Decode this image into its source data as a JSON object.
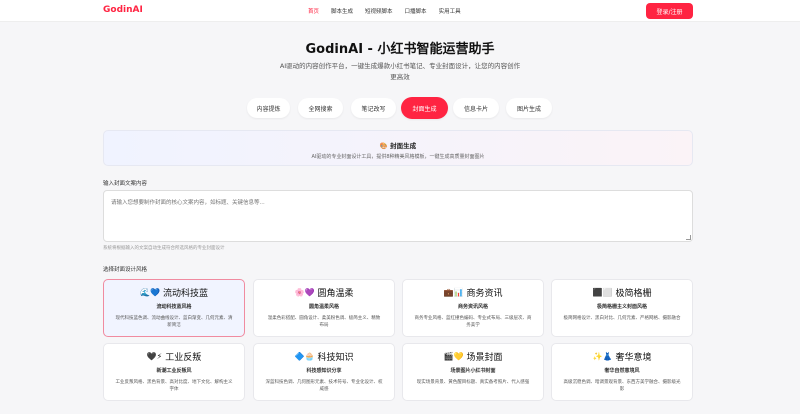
{
  "nav": {
    "logo": "GodinAI",
    "links": [
      "首页",
      "脚本生成",
      "短视频脚本",
      "口播脚本",
      "实用工具"
    ],
    "active_index": 0,
    "login_label": "登录/注册"
  },
  "hero": {
    "title": "GodinAI - 小红书智能运营助手",
    "subtitle_line1": "AI驱动的内容创作平台，一键生成爆款小红书笔记、专业封面设计，让您的内容创作",
    "subtitle_line2": "更高效"
  },
  "tabs": [
    "内容提炼",
    "全网搜索",
    "笔记改写",
    "封面生成",
    "信息卡片",
    "图片生成"
  ],
  "active_tab": 3,
  "info": {
    "title": "🎨 封面生成",
    "desc": "AI驱动的专业封面设计工具，提供8种精美风格模板，一键生成高质量封面图片"
  },
  "input": {
    "label": "输入封面文案内容",
    "placeholder": "请输入您想要制作封面的核心文案内容，如标题、关键信息等...",
    "hint": "系统将根据输入的文案自动生成符合所选风格的专业封面设计"
  },
  "styles_label": "选择封面设计风格",
  "styles": [
    {
      "emoji": "🌊💙",
      "name": "流动科技蓝",
      "subtitle": "流动科技蓝风格",
      "desc_line1": "现代科技蓝色调、流动曲线设计、蓝白渐变、几何元素、清",
      "desc_line2": "新简洁"
    },
    {
      "emoji": "🌸💜",
      "name": "圆角温柔",
      "subtitle": "圆角温柔风格",
      "desc_line1": "温柔色彩搭配、圆角设计、柔美粉色调、极简主义、精致",
      "desc_line2": "布局"
    },
    {
      "emoji": "💼📊",
      "name": "商务资讯",
      "subtitle": "商务资讯风格",
      "desc_line1": "商务专业风格、蓝红撞色编码、专业式布局、三级层次、商",
      "desc_line2": "务美学"
    },
    {
      "emoji": "⬛⬜",
      "name": "极简格栅",
      "subtitle": "极简格栅主义封面风格",
      "desc_line1": "极简网格设计、黑白对比、几何元素、严格网格、摄影融合",
      "desc_line2": ""
    },
    {
      "emoji": "🖤⚡",
      "name": "工业反叛",
      "subtitle": "新潮工业反叛风",
      "desc_line1": "工业反叛风格、黑色背景、高对比度、地下文化、解构主义",
      "desc_line2": "字体"
    },
    {
      "emoji": "🔷🧁",
      "name": "科技知识",
      "subtitle": "科技感知识分享",
      "desc_line1": "深蓝科技色调、几何图形元素、技术符号、专业化设计、权",
      "desc_line2": "威感"
    },
    {
      "emoji": "🎬💛",
      "name": "场景封面",
      "subtitle": "场景图片小红书封面",
      "desc_line1": "现实场景背景、黄色醒目标题、真实备考照片、代入感强",
      "desc_line2": ""
    },
    {
      "emoji": "✨👗",
      "name": "奢华意境",
      "subtitle": "奢华自然意境风",
      "desc_line1": "高级沉稳色调、暗调景观背景、东西方美学融合、摄影级光",
      "desc_line2": "影"
    }
  ],
  "selected_style": 0,
  "colors": {
    "accent": "#ff2442",
    "selected_border": "#f08ba0",
    "selected_bg": "#f1f4ff"
  }
}
